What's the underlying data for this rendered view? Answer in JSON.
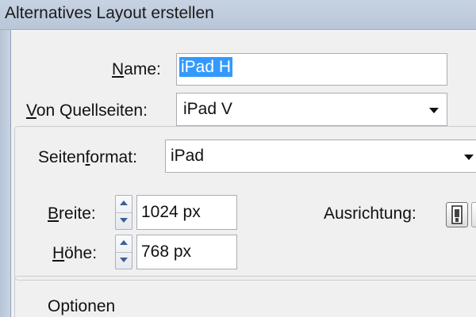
{
  "window": {
    "title": "Alternatives Layout erstellen"
  },
  "name_field": {
    "label_ul": "N",
    "label_rest": "ame:",
    "value": "iPad H"
  },
  "source_pages": {
    "label_ul": "V",
    "label_rest": "on Quellseiten:",
    "selected": "iPad V"
  },
  "page_format": {
    "label_pre": "Seiten",
    "label_ul": "f",
    "label_rest": "ormat:",
    "selected": "iPad"
  },
  "width_field": {
    "label_ul": "B",
    "label_rest": "reite:",
    "value": "1024 px"
  },
  "height_field": {
    "label_ul": "H",
    "label_rest": "öhe:",
    "value": "768 px"
  },
  "orientation": {
    "label": "Ausrichtung:",
    "icon": "portrait-orientation-icon"
  },
  "options_group": {
    "label": "Optionen"
  }
}
